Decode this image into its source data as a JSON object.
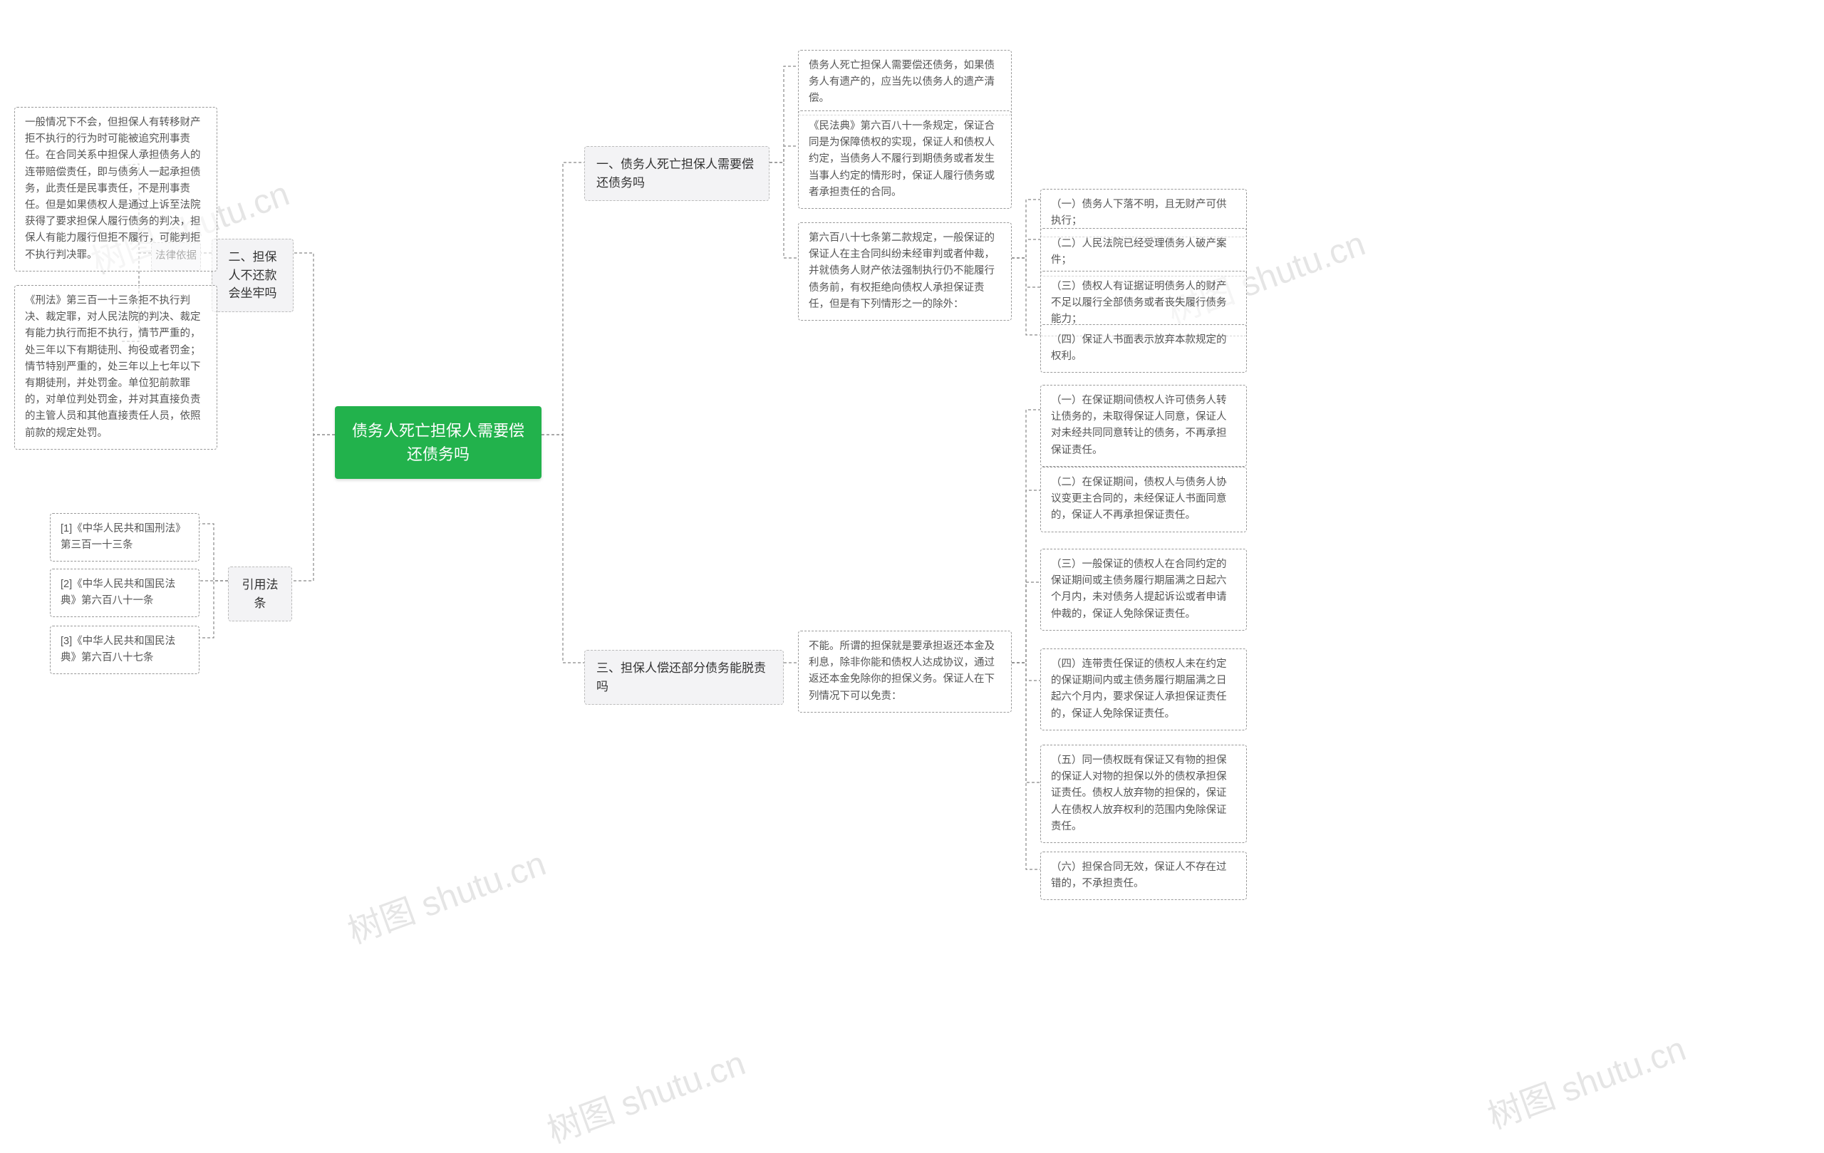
{
  "watermark": "树图 shutu.cn",
  "root": "债务人死亡担保人需要偿还债务吗",
  "left": {
    "branch2": "二、担保人不还款会坐牢吗",
    "branch_ref": "引用法条",
    "b2_legal_basis": "法律依据",
    "b2_text1": "一般情况下不会，但担保人有转移财产拒不执行的行为时可能被追究刑事责任。在合同关系中担保人承担债务人的连带赔偿责任，即与债务人一起承担债务，此责任是民事责任，不是刑事责任。但是如果债权人是通过上诉至法院获得了要求担保人履行债务的判决，担保人有能力履行但拒不履行，可能判拒不执行判决罪。",
    "b2_text2": "《刑法》第三百一十三条拒不执行判决、裁定罪，对人民法院的判决、裁定有能力执行而拒不执行，情节严重的，处三年以下有期徒刑、拘役或者罚金；情节特别严重的，处三年以上七年以下有期徒刑，并处罚金。单位犯前款罪的，对单位判处罚金，并对其直接负责的主管人员和其他直接责任人员，依照前款的规定处罚。",
    "ref1": "[1]《中华人民共和国刑法》第三百一十三条",
    "ref2": "[2]《中华人民共和国民法典》第六百八十一条",
    "ref3": "[3]《中华人民共和国民法典》第六百八十七条"
  },
  "right": {
    "branch1": "一、债务人死亡担保人需要偿还债务吗",
    "branch3": "三、担保人偿还部分债务能脱责吗",
    "b1_text1": "债务人死亡担保人需要偿还债务，如果债务人有遗产的，应当先以债务人的遗产清偿。",
    "b1_text2": "《民法典》第六百八十一条规定，保证合同是为保障债权的实现，保证人和债权人约定，当债务人不履行到期债务或者发生当事人约定的情形时，保证人履行债务或者承担责任的合同。",
    "b1_text3": "第六百八十七条第二款规定，一般保证的保证人在主合同纠纷未经审判或者仲裁，并就债务人财产依法强制执行仍不能履行债务前，有权拒绝向债权人承担保证责任，但是有下列情形之一的除外：",
    "b1_sub1": "（一）债务人下落不明，且无财产可供执行；",
    "b1_sub2": "（二）人民法院已经受理债务人破产案件；",
    "b1_sub3": "（三）债权人有证据证明债务人的财产不足以履行全部债务或者丧失履行债务能力；",
    "b1_sub4": "（四）保证人书面表示放弃本款规定的权利。",
    "b3_text": "不能。所谓的担保就是要承担返还本金及利息，除非你能和债权人达成协议，通过返还本金免除你的担保义务。保证人在下列情况下可以免责：",
    "b3_sub1": "（一）在保证期间债权人许可债务人转让债务的，未取得保证人同意，保证人对未经共同同意转让的债务，不再承担保证责任。",
    "b3_sub2": "（二）在保证期间，债权人与债务人协议变更主合同的，未经保证人书面同意的，保证人不再承担保证责任。",
    "b3_sub3": "（三）一般保证的债权人在合同约定的保证期间或主债务履行期届满之日起六个月内，未对债务人提起诉讼或者申请仲裁的，保证人免除保证责任。",
    "b3_sub4": "（四）连带责任保证的债权人未在约定的保证期间内或主债务履行期届满之日起六个月内，要求保证人承担保证责任的，保证人免除保证责任。",
    "b3_sub5": "（五）同一债权既有保证又有物的担保的保证人对物的担保以外的债权承担保证责任。债权人放弃物的担保的，保证人在债权人放弃权利的范围内免除保证责任。",
    "b3_sub6": "（六）担保合同无效，保证人不存在过错的，不承担责任。"
  }
}
